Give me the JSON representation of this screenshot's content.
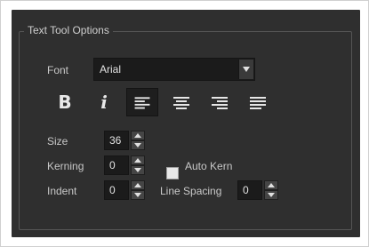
{
  "group": {
    "title": "Text Tool Options"
  },
  "font": {
    "label": "Font",
    "value": "Arial"
  },
  "format_buttons": [
    {
      "name": "bold-button",
      "glyph": "B",
      "icon": "bold-icon"
    },
    {
      "name": "italic-button",
      "glyph": "i",
      "icon": "italic-icon"
    },
    {
      "name": "align-left-button",
      "icon": "align-left-icon",
      "active": true
    },
    {
      "name": "align-center-button",
      "icon": "align-center-icon"
    },
    {
      "name": "align-right-button",
      "icon": "align-right-icon"
    },
    {
      "name": "justify-button",
      "icon": "justify-icon"
    }
  ],
  "size": {
    "label": "Size",
    "value": "36"
  },
  "kerning": {
    "label": "Kerning",
    "value": "0"
  },
  "auto_kern": {
    "label": "Auto Kern",
    "checked": false
  },
  "indent": {
    "label": "Indent",
    "value": "0"
  },
  "line_spacing": {
    "label": "Line Spacing",
    "value": "0"
  },
  "colors": {
    "panel_bg": "#2f2f2f",
    "field_bg": "#1b1b1b",
    "text": "#c8c8c8",
    "active_button": "#1e1e1e"
  }
}
